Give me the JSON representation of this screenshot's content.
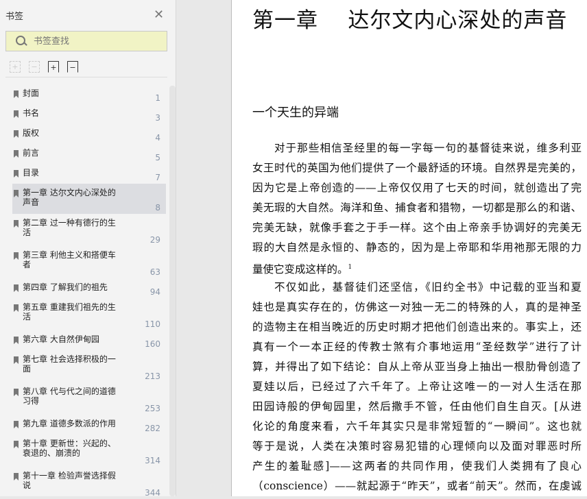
{
  "sidebar": {
    "title": "书签",
    "search_placeholder": "书签查找",
    "items": [
      {
        "label": "封面",
        "page": "1"
      },
      {
        "label": "书名",
        "page": "3"
      },
      {
        "label": "版权",
        "page": "4"
      },
      {
        "label": "前言",
        "page": "5"
      },
      {
        "label": "目录",
        "page": "7"
      },
      {
        "label": "第一章  达尔文内心深处的声音",
        "page": "8"
      },
      {
        "label": "第二章  过一种有德行的生活",
        "page": "29"
      },
      {
        "label": "第三章  利他主义和搭便车者",
        "page": "63"
      },
      {
        "label": "第四章  了解我们的祖先",
        "page": "94"
      },
      {
        "label": "第五章  重建我们祖先的生活",
        "page": "110"
      },
      {
        "label": "第六章  大自然伊甸园",
        "page": "160"
      },
      {
        "label": "第七章  社会选择积极的一面",
        "page": "213"
      },
      {
        "label": "第八章  代与代之间的道德习得",
        "page": "253"
      },
      {
        "label": "第九章  道德多数派的作用",
        "page": "282"
      },
      {
        "label": "第十章  更新世：兴起的、衰退的、崩溃的",
        "page": "314"
      },
      {
        "label": "第十一章  检验声誉选择假说",
        "page": "344"
      }
    ]
  },
  "document": {
    "chapter_title": "第一章    达尔文内心深处的声音",
    "section_title": "一个天生的异端",
    "lines": [
      "对于那些相信圣经里的每一字每一句的基督徒来说，维多利亚",
      "女王时代的英国为他们提供了一个最舒适的环境。自然界是完美的，",
      "因为它是上帝创造的——上帝仅仅用了七天的时间，就创造出了完",
      "美无瑕的大自然。海洋和鱼、捕食者和猎物，一切都是那么的和谐、",
      "完美无缺，就像手套之于手一样。这个由上帝亲手协调好的完美无",
      "瑕的大自然是永恒的、静态的，因为是上帝耶和华用祂那无限的力",
      "量使它变成这样的。",
      "不仅如此，基督徒们还坚信，《旧约全书》中记载的亚当和夏",
      "娃也是真实存在的，仿佛这一对独一无二的特殊的人，真的是神圣",
      "的造物主在相当晚近的历史时期才把他们创造出来的。事实上，还",
      "真有一个一本正经的传教士煞有介事地运用“圣经数学”进行了计",
      "算，并得出了如下结论：自从上帝从亚当身上抽出一根肋骨创造了",
      "夏娃以后，已经过了六千年了。上帝让这唯一的一对人生活在那",
      "田园诗般的伊甸园里，然后撒手不管，任由他们自生自灭。[从进",
      "化论的角度来看，六千年其实只是非常短暂的“一瞬间”。这也就",
      "等于是说，人类在决策时容易犯错的心理倾向以及面对罪恶时所",
      "产生的羞耻感]——这两者的共同作用，使我们人类拥有了良心",
      "（conscience）——就起源于“昨天”，或者“前天”。然而，在虔诚"
    ],
    "footnote_mark": "1"
  }
}
